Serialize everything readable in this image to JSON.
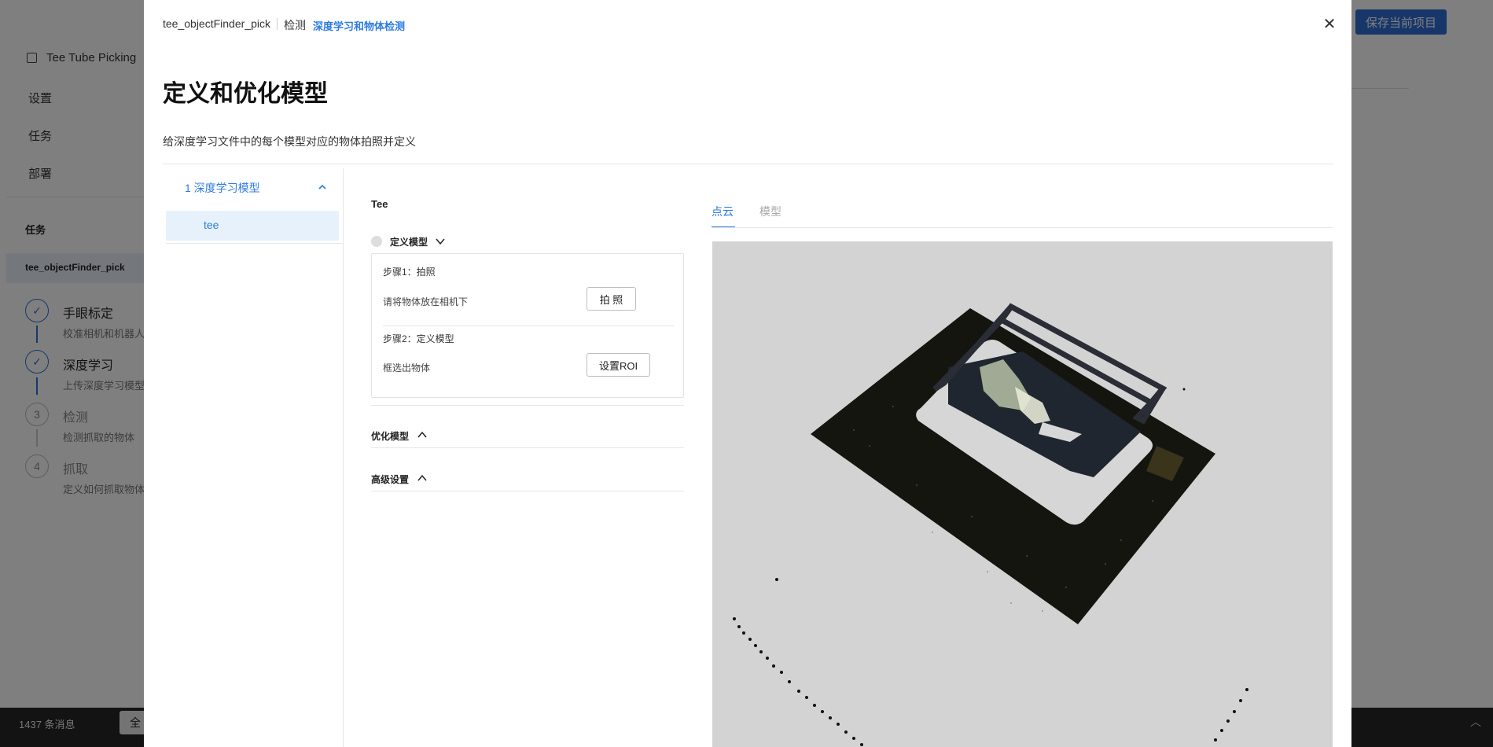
{
  "background": {
    "nav": [
      "Tee Tube Picking",
      "设置",
      "任务",
      "部署"
    ],
    "section_label": "任务",
    "task_name": "tee_objectFinder_pick",
    "steps": [
      {
        "num": "✓",
        "title": "手眼标定",
        "sub": "校准相机和机器人",
        "done": true
      },
      {
        "num": "✓",
        "title": "深度学习",
        "sub": "上传深度学习模型",
        "done": true
      },
      {
        "num": "3",
        "title": "检测",
        "sub": "检测抓取的物体",
        "done": false
      },
      {
        "num": "4",
        "title": "抓取",
        "sub": "定义如何抓取物体",
        "done": false
      }
    ],
    "save_button": "保存当前项目",
    "message_count": "1437 条消息",
    "all_button": "全"
  },
  "modal": {
    "breadcrumb": [
      "tee_objectFinder_pick",
      "检测",
      "深度学习和物体检测"
    ],
    "title": "定义和优化模型",
    "subtitle": "给深度学习文件中的每个模型对应的物体拍照并定义",
    "tree": {
      "group": "1 深度学习模型",
      "item": "tee"
    },
    "model_name": "Tee",
    "define_section": "定义模型",
    "step1_title": "步骤1：拍照",
    "step1_desc": "请将物体放在相机下",
    "capture_button": "拍 照",
    "step2_title": "步骤2：定义模型",
    "step2_desc": "框选出物体",
    "roi_button": "设置ROI",
    "optimize_section": "优化模型",
    "advanced_section": "高级设置",
    "tabs": [
      "点云",
      "模型"
    ]
  },
  "colors": {
    "accent": "#2f7be0",
    "brand_button": "#2f6fd6",
    "viewer_bg": "#d3d3d3"
  }
}
